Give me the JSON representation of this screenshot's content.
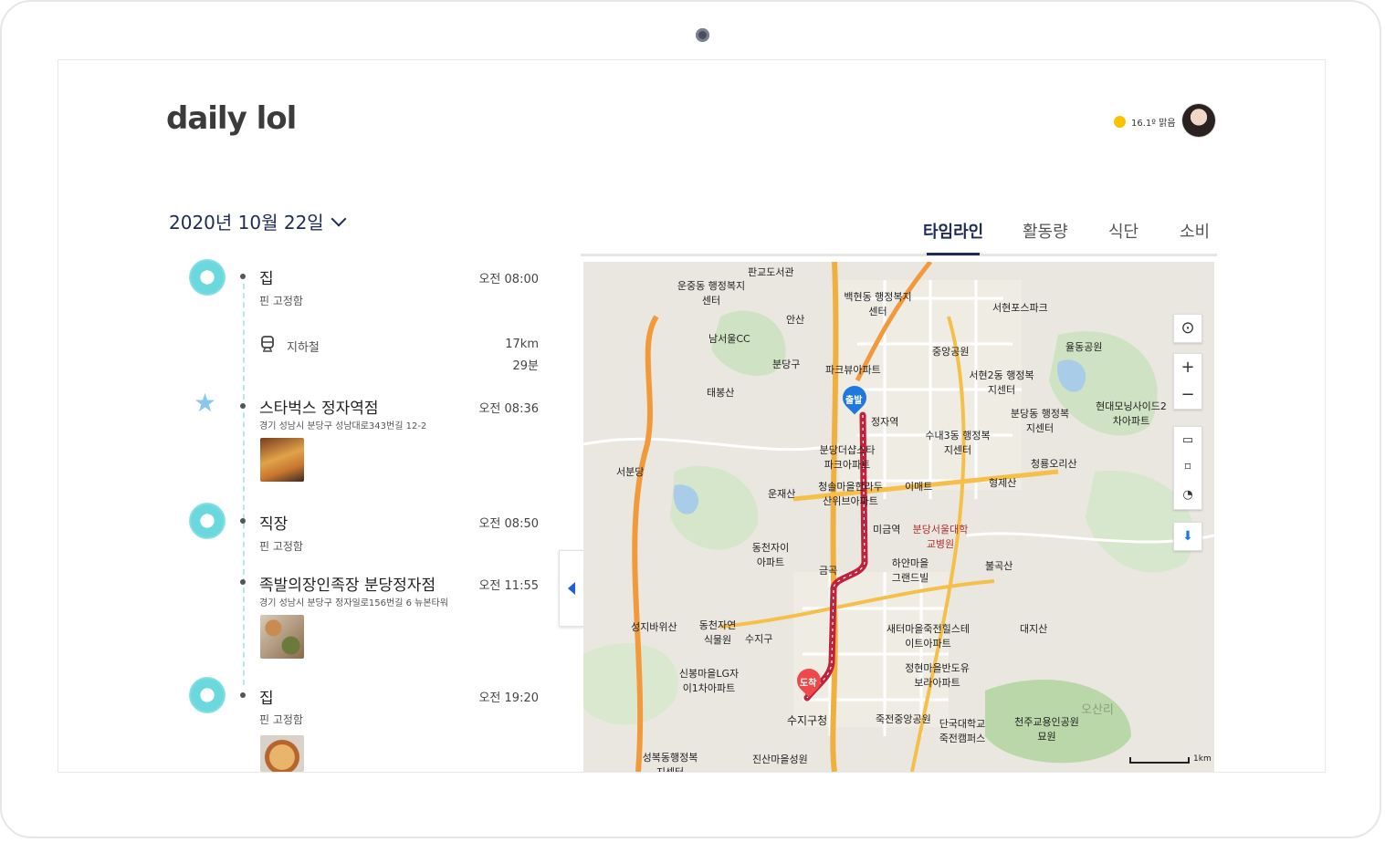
{
  "app": {
    "logo": "daily lol"
  },
  "weather": {
    "text": "16.1º 맑음",
    "icon": "sun-icon"
  },
  "date": {
    "label": "2020년 10월 22일"
  },
  "tabs": [
    {
      "label": "타임라인",
      "active": true
    },
    {
      "label": "활동량",
      "active": false
    },
    {
      "label": "식단",
      "active": false
    },
    {
      "label": "소비",
      "active": false
    }
  ],
  "timeline": {
    "items": [
      {
        "title": "집",
        "sub": "핀 고정함",
        "time": "오전 08:00"
      },
      {
        "transport": "지하철",
        "distance": "17km",
        "duration": "29분"
      },
      {
        "title": "스타벅스 정자역점",
        "address": "경기 성남시 분당구 성남대로343번길 12-2",
        "time": "오전 08:36"
      },
      {
        "title": "직장",
        "sub": "핀 고정함",
        "time": "오전 08:50"
      },
      {
        "title": "족발의장인족장 분당정자점",
        "address": "경기 성남시 분당구 정자일로156번길 6 뉴본타워",
        "time": "오전 11:55"
      },
      {
        "title": "집",
        "sub": "핀 고정함",
        "time": "오전 19:20"
      }
    ]
  },
  "map": {
    "start_label": "출발",
    "end_label": "도착",
    "scale_label": "1km",
    "labels": [
      "판교도서관",
      "운중동 행정복지센터",
      "백현동 행정복지센터",
      "안산",
      "남서울CC",
      "분당구",
      "파크뷰아파트",
      "중앙공원",
      "서현2동 행정복지센터",
      "서현포스파크",
      "율동공원",
      "분당동 행정복지센터",
      "태봉산",
      "정자역",
      "수내3동 행정복지센터",
      "현대모닝사이드2차아파트",
      "서분당",
      "분당더샵스타파크아파트",
      "이매트",
      "형제산",
      "청룡오리산",
      "운재산",
      "청솔마을한라두산위브아파트",
      "미금역",
      "분당서울대학교병원",
      "동천자이아파트",
      "금곡",
      "하얀마을그랜드빌",
      "불곡산",
      "성지바위산",
      "동천자연식물원",
      "수지구",
      "새터마을죽전힐스테이트아파트",
      "대지산",
      "신봉마을LG자이1차아파트",
      "수지구청",
      "정현마을반도유보라아파트",
      "죽전중앙공원",
      "단국대학교죽전캠퍼스",
      "천주교용인공원묘원",
      "성복동행정복지센터",
      "진산마을성원",
      "오산리"
    ]
  },
  "colors": {
    "accent": "#1f2b55",
    "route": "#c0213b",
    "timeline": "#6ad8dd",
    "start_pin": "#1e78e0",
    "end_pin": "#ef4a4a"
  }
}
